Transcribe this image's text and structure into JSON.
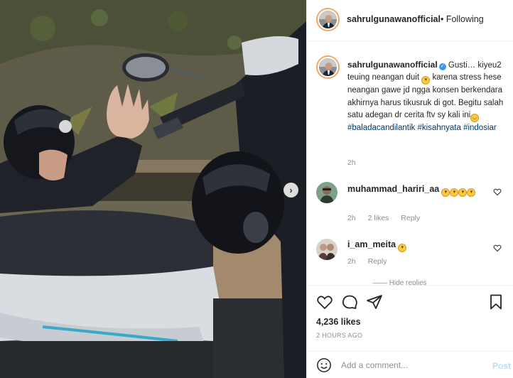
{
  "post": {
    "username": "sahrulgunawanofficial",
    "follow_status": "• Following",
    "caption": {
      "username": "sahrulgunawanofficial",
      "text_1": "Gusti… kiyeu2 teuing neangan duit",
      "text_2": "karena stress hese neangan gawe jd ngga konsen berkendara akhirnya harus tikusruk di got. Begitu salah satu adegan dr cerita ftv sy kali ini",
      "hashtags": [
        "#baladacandilantik",
        "#kisahnyata",
        "#indosiar"
      ],
      "time": "2h"
    },
    "comments": [
      {
        "username": "muhammad_hariri_aa",
        "time": "2h",
        "likes": "2 likes",
        "reply": "Reply"
      },
      {
        "username": "i_am_meita",
        "time": "2h",
        "reply": "Reply"
      }
    ],
    "hide_replies": "—— Hide replies",
    "likes": "4,236 likes",
    "ago": "2 HOURS AGO",
    "add_comment_placeholder": "Add a comment...",
    "post_label": "Post"
  },
  "icons": {
    "verified": "verified-badge-icon",
    "heart": "heart-icon",
    "comment": "comment-icon",
    "share": "share-icon",
    "save": "bookmark-icon",
    "emoji": "emoji-icon",
    "next": "chevron-right-icon"
  },
  "colors": {
    "link": "#00376b",
    "verified": "#3897f0",
    "muted": "#8e8e8e",
    "post_button": "#b2dffc",
    "story_ring": "#f3a86b"
  }
}
